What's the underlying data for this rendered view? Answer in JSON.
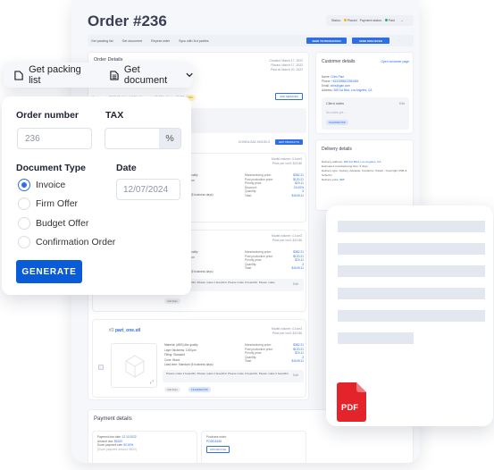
{
  "order": {
    "title": "Order #236",
    "status_label": "Status:",
    "status_value": "Placed",
    "payment_status_label": "Payment status:",
    "payment_status_value": "Paid"
  },
  "toolbar": {
    "packing_list": "Get packing list",
    "get_document": "Get document",
    "repeat_order": "Repeat order",
    "sync": "Sync with 3rd parties",
    "send_production": "SEND TO PRODUCTION",
    "send_firm_offer": "SEND FIRM OFFER"
  },
  "order_details": {
    "title": "Order Details",
    "created": "Created: March 17, 2022",
    "placed": "Placed: March 17, 2022",
    "paid": "Paid at: March 20, 2022",
    "starter_cost_label": "Starter cost:",
    "starter_cost": "$109.00",
    "tax_label": "TAX:",
    "tax": "0.00%",
    "discounts_label": "Discounts:",
    "discounts": "15.00%",
    "totals_label": "Totals:",
    "totals": "$1720",
    "badge": "TBD",
    "add_services": "ADD SERVICES",
    "download_models": "DOWNLOAD MODELS",
    "edit_products": "EDIT PRODUCTS"
  },
  "products": [
    {
      "name": "",
      "model_volume": "Model volume: 4.1cm3",
      "price_per_cm3": "Price per cm3: $13.86",
      "specs": [
        "Material: (ABS)-like quality",
        "Layer thickness: 100µm",
        "Filling: Standard",
        "Color: Black",
        "Lead time: Standard (5 business days)"
      ],
      "prices": [
        [
          "Manufacturing price:",
          "$382.21"
        ],
        [
          "Post production price:",
          "$120.21"
        ],
        [
          "Priority price:",
          "$20.11"
        ],
        [
          "Discount:",
          "15.00%"
        ],
        [
          "Quantity:",
          "3"
        ],
        [
          "Total:",
          "$1049.11"
        ]
      ],
      "add_files": "Add Files"
    },
    {
      "name": "",
      "model_volume": "Model volume: 4.1cm3",
      "price_per_cm3": "Price per cm3: $13.86",
      "specs": [
        "Material: (ABS)-like quality",
        "Layer thickness: 100µm",
        "Filling: Standard",
        "Color: Black",
        "Lead time: Standard (5 business days)"
      ],
      "prices": [
        [
          "Manufacturing price:",
          "$382.21"
        ],
        [
          "Post production price:",
          "$120.21"
        ],
        [
          "Priority price:",
          "$20.11"
        ],
        [
          "Quantity:",
          "3"
        ],
        [
          "Total:",
          "$1049.11"
        ]
      ],
      "note": "Please make it beautiful. Please make it beautiful. Please make it beautiful. Please make",
      "edit": "Edit",
      "add_files": "Add Files"
    },
    {
      "index": "#3",
      "name": "part_one.stl",
      "model_volume": "Model volume: 4.1cm3",
      "price_per_cm3": "Price per cm3: $13.86",
      "specs": [
        "Material: (ABS)-like quality",
        "Layer thickness: 1000µm",
        "Filling: Standard",
        "Color: Black",
        "Lead time: Standard (5 business days)"
      ],
      "prices": [
        [
          "Manufacturing price:",
          "$382.21"
        ],
        [
          "Post production price:",
          "$120.21"
        ],
        [
          "Priority price:",
          "$20.11"
        ],
        [
          "Quantity:",
          "3"
        ],
        [
          "Total:",
          "$1049.11"
        ]
      ],
      "note": "Please make it beautiful. Please make it beautiful. Please make it beautiful. Please make it beautiful.",
      "edit": "Edit",
      "add_files": "Add Files",
      "file_chip": "FILE2REF.PDF"
    }
  ],
  "customer": {
    "title": "Customer details",
    "open_link": "Open customer page",
    "name_label": "Name:",
    "name": "Chris Paul",
    "phone_label": "Phone:",
    "phone": "+6232895622353455",
    "email_label": "Email:",
    "email": "chris@gan.com",
    "address_label": "Address:",
    "address": "365 1st Blvd, Los Angeles, CA",
    "notes_title": "Client notes",
    "notes_edit": "Edit",
    "notes_empty": "No notes yet...",
    "notes_chip": "FILE2REF.PDF"
  },
  "delivery": {
    "title": "Delivery details",
    "address_label": "Delivery address:",
    "address": "365 1st Blvd, Los Angeles, CA",
    "time_label": "Estimated manufacturing time:",
    "time": "5 days",
    "type_label": "Delivery type:",
    "type": "Sydney, Adelaide, Canberra, Hobart - Overnight OSB & Suburbs",
    "price_label": "Delivery price:",
    "price": "$65"
  },
  "payment": {
    "title": "Payment details",
    "due_label": "Payment due date:",
    "due": "12.10.2022",
    "amount_label": "Amount due:",
    "amount": "$1000",
    "down_rate_label": "Down payment rate:",
    "down_rate": "50.00%",
    "down_amount": "(Down payment amount: $500)",
    "po_label": "Purchase order:",
    "po": "PO2816165",
    "upload": "UPLOAD FILE"
  },
  "float_toolbar": {
    "packing_list": "Get packing list",
    "get_document": "Get document"
  },
  "form": {
    "order_number_label": "Order number",
    "order_number_value": "236",
    "tax_label": "TAX",
    "tax_value": "",
    "tax_unit": "%",
    "doc_type_label": "Document Type",
    "date_label": "Date",
    "date_value": "12/07/2024",
    "doc_types": [
      "Invoice",
      "Firm Offer",
      "Budget Offer",
      "Confirmation Order"
    ],
    "selected_doc_type": "Invoice",
    "generate": "GENERATE"
  },
  "pdf_preview": {
    "badge": "PDF"
  },
  "colors": {
    "accent": "#0a5bd8",
    "link": "#2f6fe4",
    "pdf_red": "#e3242b"
  }
}
